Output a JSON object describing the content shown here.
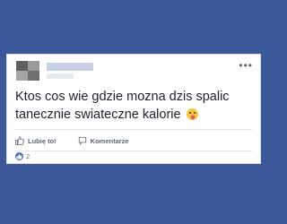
{
  "post": {
    "text": "Ktos cos wie gdzie mozna dzis spalic tanecznie swiateczne kalorie",
    "emoji": "tongue-out-emoji"
  },
  "actions": {
    "like_label": "Lubię to!",
    "comment_label": "Komentarze"
  },
  "reactions": {
    "count": "2"
  },
  "colors": {
    "background": "#3b5998",
    "accent": "#4267b2",
    "text": "#1d2129",
    "muted": "#606770"
  }
}
